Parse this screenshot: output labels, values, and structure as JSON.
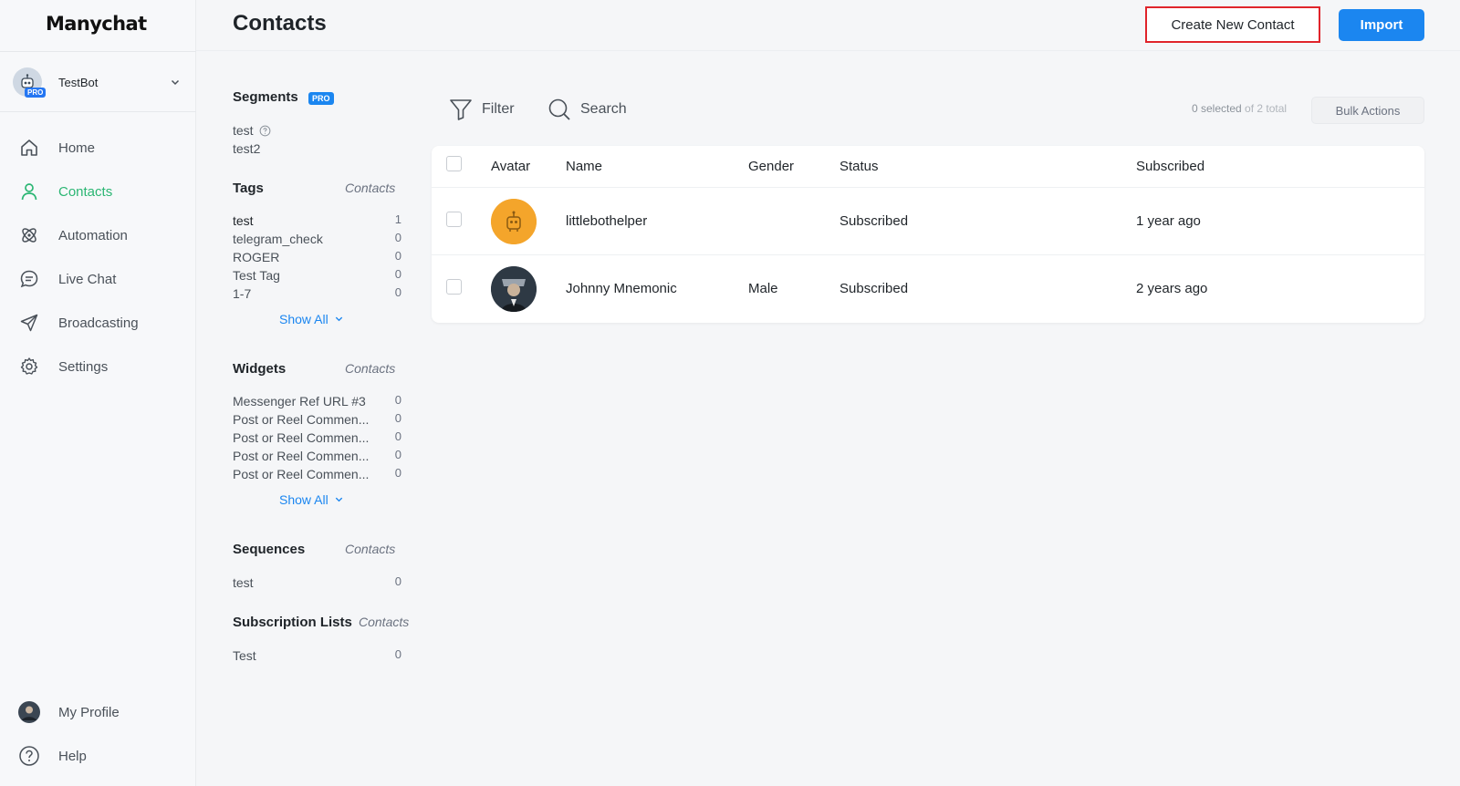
{
  "app": {
    "logo": "Manychat"
  },
  "bot": {
    "name": "TestBot",
    "badge": "PRO"
  },
  "nav": [
    {
      "label": "Home",
      "icon": "home-icon"
    },
    {
      "label": "Contacts",
      "icon": "contacts-icon",
      "active": true
    },
    {
      "label": "Automation",
      "icon": "automation-icon"
    },
    {
      "label": "Live Chat",
      "icon": "chat-icon"
    },
    {
      "label": "Broadcasting",
      "icon": "send-icon"
    },
    {
      "label": "Settings",
      "icon": "gear-icon"
    }
  ],
  "bottom_nav": [
    {
      "label": "My Profile",
      "icon": "avatar"
    },
    {
      "label": "Help",
      "icon": "help-icon"
    }
  ],
  "header": {
    "title": "Contacts",
    "create_label": "Create New Contact",
    "import_label": "Import"
  },
  "segments": {
    "title": "Segments",
    "badge": "PRO",
    "items": [
      "test",
      "test2"
    ]
  },
  "tags": {
    "title": "Tags",
    "sub": "Contacts",
    "items": [
      {
        "label": "test",
        "count": "1"
      },
      {
        "label": "telegram_check",
        "count": "0"
      },
      {
        "label": "ROGER",
        "count": "0"
      },
      {
        "label": "Test Tag",
        "count": "0"
      },
      {
        "label": "1-7",
        "count": "0"
      }
    ],
    "show_all": "Show All"
  },
  "widgets": {
    "title": "Widgets",
    "sub": "Contacts",
    "items": [
      {
        "label": "Messenger Ref URL #3",
        "count": "0"
      },
      {
        "label": "Post or Reel Commen...",
        "count": "0"
      },
      {
        "label": "Post or Reel Commen...",
        "count": "0"
      },
      {
        "label": "Post or Reel Commen...",
        "count": "0"
      },
      {
        "label": "Post or Reel Commen...",
        "count": "0"
      }
    ],
    "show_all": "Show All"
  },
  "sequences": {
    "title": "Sequences",
    "sub": "Contacts",
    "items": [
      {
        "label": "test",
        "count": "0"
      }
    ]
  },
  "subscription_lists": {
    "title": "Subscription Lists",
    "sub": "Contacts",
    "items": [
      {
        "label": "Test",
        "count": "0"
      }
    ]
  },
  "toolbar": {
    "filter_label": "Filter",
    "search_label": "Search",
    "selected_a": "0 selected",
    "selected_b": " of 2 total",
    "bulk_label": "Bulk Actions"
  },
  "table": {
    "columns": [
      "Avatar",
      "Name",
      "Gender",
      "Status",
      "Subscribed"
    ],
    "rows": [
      {
        "name": "littlebothelper",
        "gender": "",
        "status": "Subscribed",
        "subscribed": "1 year ago"
      },
      {
        "name": "Johnny Mnemonic",
        "gender": "Male",
        "status": "Subscribed",
        "subscribed": "2 years ago"
      }
    ]
  },
  "colors": {
    "accent_green": "#2bb673",
    "primary_blue": "#1b86f0",
    "highlight_red": "#e0242b"
  }
}
